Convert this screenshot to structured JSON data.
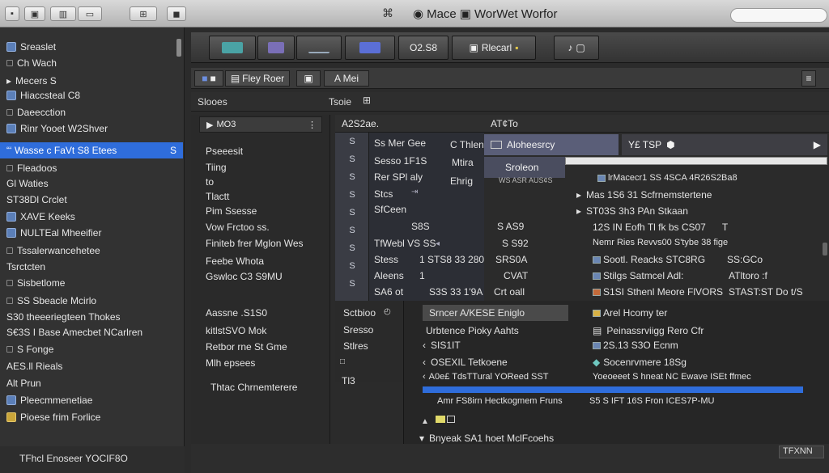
{
  "colors": {
    "accent": "#2f6ddb",
    "titlebar": "#c4c4c4",
    "sidebar_bg": "#323232",
    "panel_bg": "#2a2a2a"
  },
  "titlebar": {
    "title_app": "Mace",
    "title_rest": "WorWet Worfor",
    "search_placeholder": ""
  },
  "sidebar": {
    "items": [
      {
        "label": "Sreaslet",
        "icon": "folder-icon"
      },
      {
        "label": "Ch Wach"
      },
      {
        "label": "Mecers  S"
      },
      {
        "label": "Hiaccsteal C8"
      },
      {
        "label": "Daeecction"
      },
      {
        "label": "Rinr Yooet W2Shver"
      },
      {
        "label": "“‘ Wasse  c FaVt S8 Etees",
        "right": "S"
      },
      {
        "label": "Fleadoos"
      },
      {
        "label": "Gl Waties"
      },
      {
        "label": "ST38Dl Crclet"
      },
      {
        "label": "XAVE Keeks"
      },
      {
        "label": "NULTEal Mheeifier"
      },
      {
        "label": "Tssalerwancehetee"
      },
      {
        "label": "Tsrctcten"
      },
      {
        "label": "Sisbetlome"
      },
      {
        "label": "SS Sbeacle Mcirlo"
      },
      {
        "label": "S30 theeeriegteen Thokes"
      },
      {
        "label": "S€3S I Base Amecbet NCarlren"
      },
      {
        "label": "S Fonge"
      },
      {
        "label": "AES.ll Rieals"
      },
      {
        "label": "Alt Prun"
      },
      {
        "label": "Pleecmmenetiae"
      },
      {
        "label": "Pioese frim Forlice"
      }
    ],
    "footer": "TFhcl Enoseer YOCIF8O"
  },
  "toolbar": {
    "buttons": [
      {
        "label": ""
      },
      {
        "label": ""
      },
      {
        "label": ""
      },
      {
        "label": ""
      },
      {
        "label": "O2.S8"
      },
      {
        "label": "Rlecarl"
      },
      {
        "label": ""
      }
    ]
  },
  "subbar": {
    "btn1": "",
    "btn2": "Fley Roer",
    "btn3": "A Mei"
  },
  "pathrow": {
    "left": "Slooes",
    "right": "Tsoie"
  },
  "leftpanel": {
    "header": "MO3",
    "items": [
      "Pseeesit",
      "Tiing",
      "to",
      "Tlactt",
      "Pim Ssesse",
      "Vow Frctoo ss.",
      "Finiteb frer Mglon Wes",
      "Feebe Whota",
      "Gswloc C3 S9MU",
      "Aassne .S1S0",
      "kitlstSVO Mok",
      "Retbor rne St Gme",
      "Mlh epsees",
      "Thtac Chrnemterere"
    ]
  },
  "colhead": {
    "c1": "A2S2ae.",
    "c2": "AT¢To",
    "c3": "Y£ TSP"
  },
  "gutter": {
    "rows": [
      "S",
      "S",
      "S",
      "S",
      "S",
      "S",
      "S",
      "S",
      "S"
    ]
  },
  "grid": {
    "col1": [
      "Ss Mer Gee",
      "Sesso 1F1S",
      "Rer SPl aly",
      "Stcs",
      "SfCeen",
      "TfWebl VS SS",
      "Stess",
      "Aleens",
      "SA6 ot"
    ],
    "col2": [
      "C Thlen",
      "Mtira",
      "Ehrig",
      "",
      "S8S",
      "",
      "1 STS8 33 280",
      "1",
      "S3S 33 1'9A"
    ],
    "col3": [
      "",
      "",
      "",
      "",
      "S AS9",
      "S S92",
      "SRS0A",
      "CVAT",
      "Crt oall"
    ]
  },
  "popup": {
    "row1": "Aloheesrcy",
    "row1_right": "Y£ TSP",
    "row2": "Sroleon",
    "row2_sub": "WS ASR AUS¢S"
  },
  "rightcol": {
    "rows": [
      "lrMacecr1 SS 4SCA 4R26S2Ba8",
      "Mas 1S6 31 Scfrnemstertene",
      "ST03S 3h3 PAn Stkaan",
      "12S IN Eofh Tl fk bs CS07",
      "Nemr Ries Revvs00 S'tybe 38 fige",
      "Sootl. Reacks STC8RG",
      "Stilgs Satmcel  Adl:",
      "S1SI Sthenl Meore FlVORS"
    ],
    "rightvals": [
      "",
      "",
      "",
      "T",
      "",
      "SS:GCo",
      "ATltoro :f",
      "STAST:ST Do t/S"
    ]
  },
  "lower": {
    "row1": "Sctbioo",
    "row2": "Sresso",
    "row3": "Stlres",
    "sel": "Srncer A/KESE  Eniglo",
    "sel_right": "Arel Hcomy ter",
    "items": [
      {
        "left": "Urbtence Pioky Aahts",
        "right": "Peinassrviigg Rero Cfr"
      },
      {
        "left": "SIS1IT",
        "right": "2S.13 S3O Ecnm"
      },
      {
        "left": "OSEXIL Tetkoene",
        "right": "Socenrvmere 18Sg"
      },
      {
        "left": "A0e£ TdsTTural YOReed SST",
        "right": "Yoeoeeet S hneat  NC Ewave ISEt ffmec"
      },
      {
        "left": "Amr FS8irn Hectkogmem Fruns",
        "right": "S5 S  IFT 16S Fron ICES7P-MU"
      },
      {
        "left": "Bnyeak SA1 hoet MclFcoehs",
        "right": ""
      }
    ]
  },
  "statusbar": {
    "left": "Tl3",
    "right": "TFXNN"
  }
}
